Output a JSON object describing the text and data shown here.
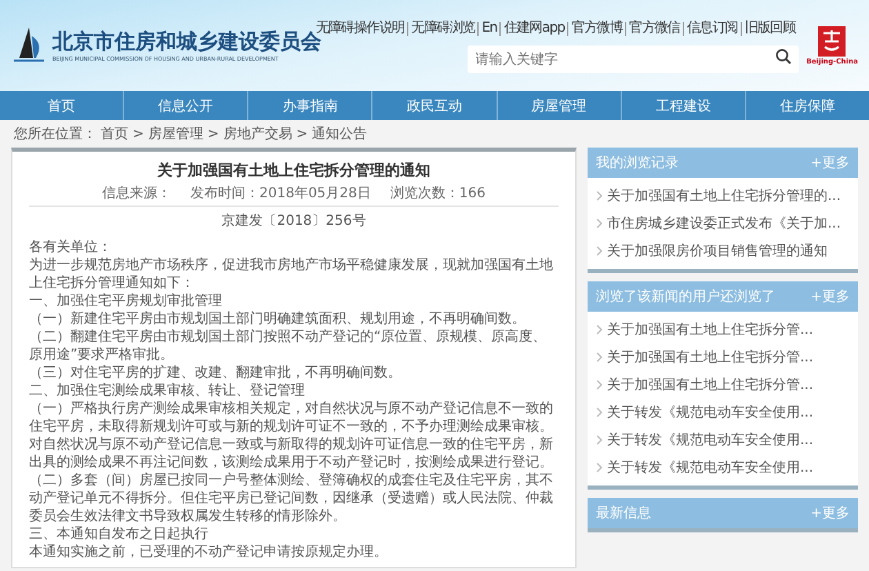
{
  "header": {
    "title": "北京市住房和城乡建设委员会",
    "subtitle": "BEIJING MUNICIPAL COMMISSION OF HOUSING AND URBAN-RURAL DEVELOPMENT",
    "links": [
      "无障碍操作说明",
      "无障碍浏览",
      "En",
      "住建网app",
      "官方微博",
      "官方微信",
      "信息订阅",
      "旧版回顾"
    ],
    "search": {
      "placeholder": "请输入关键字"
    },
    "emblem_caption": "Beijing-China"
  },
  "nav": [
    "首页",
    "信息公开",
    "办事指南",
    "政民互动",
    "房屋管理",
    "工程建设",
    "住房保障"
  ],
  "breadcrumb": {
    "label": "您所在位置：",
    "separator": ">",
    "items": [
      "首页",
      "房屋管理",
      "房地产交易",
      "通知公告"
    ]
  },
  "article": {
    "title": "关于加强国有土地上住宅拆分管理的通知",
    "meta": [
      "信息来源：",
      "发布时间：2018年05月28日",
      "浏览次数：166"
    ],
    "doc_number": "京建发〔2018〕256号",
    "paragraphs": [
      "各有关单位：",
      "为进一步规范房地产市场秩序，促进我市房地产市场平稳健康发展，现就加强国有土地上住宅拆分管理通知如下：",
      "一、加强住宅平房规划审批管理",
      "（一）新建住宅平房由市规划国土部门明确建筑面积、规划用途，不再明确间数。",
      "（二）翻建住宅平房由市规划国土部门按照不动产登记的“原位置、原规模、原高度、原用途”要求严格审批。",
      "（三）对住宅平房的扩建、改建、翻建审批，不再明确间数。",
      "二、加强住宅测绘成果审核、转让、登记管理",
      "（一）严格执行房产测绘成果审核相关规定，对自然状况与原不动产登记信息不一致的住宅平房，未取得新规划许可或与新的规划许可证不一致的，不予办理测绘成果审核。对自然状况与原不动产登记信息一致或与新取得的规划许可证信息一致的住宅平房，新出具的测绘成果不再注记间数，该测绘成果用于不动产登记时，按测绘成果进行登记。",
      "（二）多套（间）房屋已按同一户号整体测绘、登簿确权的成套住宅及住宅平房，其不动产登记单元不得拆分。但住宅平房已登记间数，因继承（受遗赠）或人民法院、仲裁委员会生效法律文书导致权属发生转移的情形除外。",
      "三、本通知自发布之日起执行",
      "本通知实施之前，已受理的不动产登记申请按原规定办理。"
    ]
  },
  "sidebar": [
    {
      "title": "我的浏览记录",
      "more": "+更多",
      "items": [
        "关于加强国有土地上住宅拆分管理的...",
        "市住房城乡建设委正式发布《关于加...",
        "关于加强限房价项目销售管理的通知"
      ]
    },
    {
      "title": "浏览了该新闻的用户还浏览了",
      "more": "+更多",
      "items": [
        "关于加强国有土地上住宅拆分管...",
        "关于加强国有土地上住宅拆分管...",
        "关于加强国有土地上住宅拆分管...",
        "关于转发《规范电动车安全使用...",
        "关于转发《规范电动车安全使用...",
        "关于转发《规范电动车安全使用..."
      ]
    },
    {
      "title": "最新信息",
      "more": "+更多"
    }
  ]
}
